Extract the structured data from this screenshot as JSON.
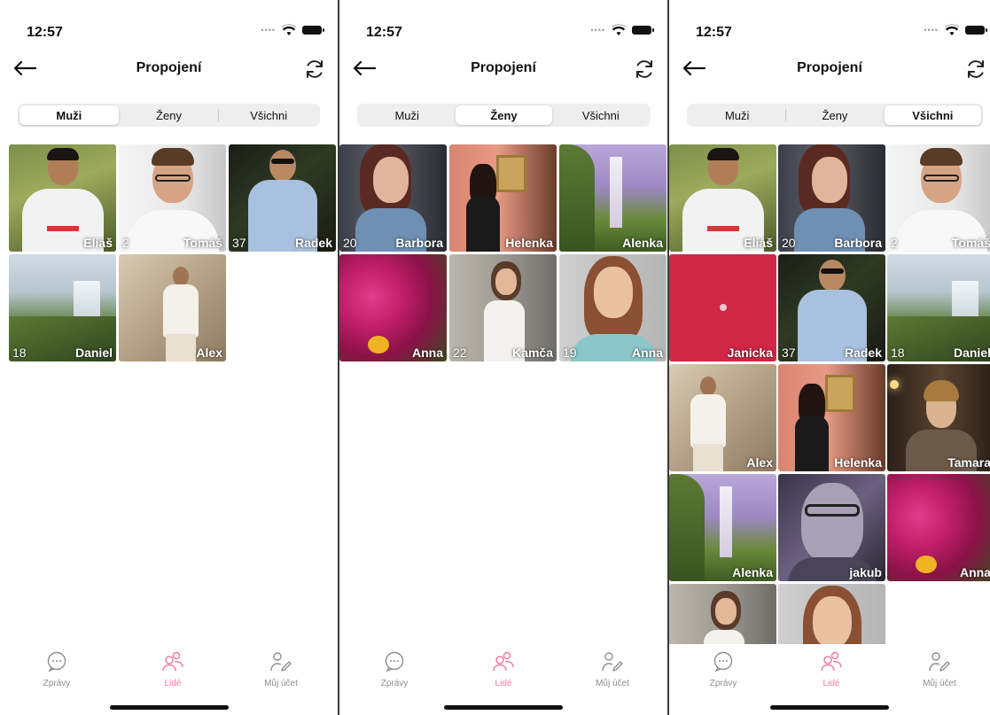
{
  "status": {
    "time": "12:57"
  },
  "header": {
    "title": "Propojení"
  },
  "segments": [
    "Muži",
    "Ženy",
    "Všichni"
  ],
  "tabs": {
    "messages": "Zprávy",
    "people": "Lidé",
    "account": "Můj účet"
  },
  "colors": {
    "accent": "#f47ca0",
    "tab_inactive": "#8e8e93"
  },
  "screens": [
    {
      "active_segment": 0,
      "tiles": [
        {
          "name": "Eliáš",
          "age": ""
        },
        {
          "name": "Tomáš",
          "age": "2"
        },
        {
          "name": "Radek",
          "age": "37"
        },
        {
          "name": "Daniel",
          "age": "18"
        },
        {
          "name": "Alex",
          "age": ""
        }
      ]
    },
    {
      "active_segment": 1,
      "tiles": [
        {
          "name": "Barbora",
          "age": "20"
        },
        {
          "name": "Helenka",
          "age": ""
        },
        {
          "name": "Alenka",
          "age": ""
        },
        {
          "name": "Anna",
          "age": ""
        },
        {
          "name": "Kamča",
          "age": "22"
        },
        {
          "name": "Anna",
          "age": "19"
        }
      ]
    },
    {
      "active_segment": 2,
      "tiles": [
        {
          "name": "Eliáš",
          "age": ""
        },
        {
          "name": "Barbora",
          "age": "20"
        },
        {
          "name": "Tomáš",
          "age": "2"
        },
        {
          "name": "Janicka",
          "age": ""
        },
        {
          "name": "Radek",
          "age": "37"
        },
        {
          "name": "Daniel",
          "age": "18"
        },
        {
          "name": "Alex",
          "age": ""
        },
        {
          "name": "Helenka",
          "age": ""
        },
        {
          "name": "Tamara",
          "age": ""
        },
        {
          "name": "Alenka",
          "age": ""
        },
        {
          "name": "jakub",
          "age": ""
        },
        {
          "name": "Anna",
          "age": ""
        },
        {
          "name": "",
          "age": ""
        },
        {
          "name": "",
          "age": ""
        }
      ]
    }
  ]
}
